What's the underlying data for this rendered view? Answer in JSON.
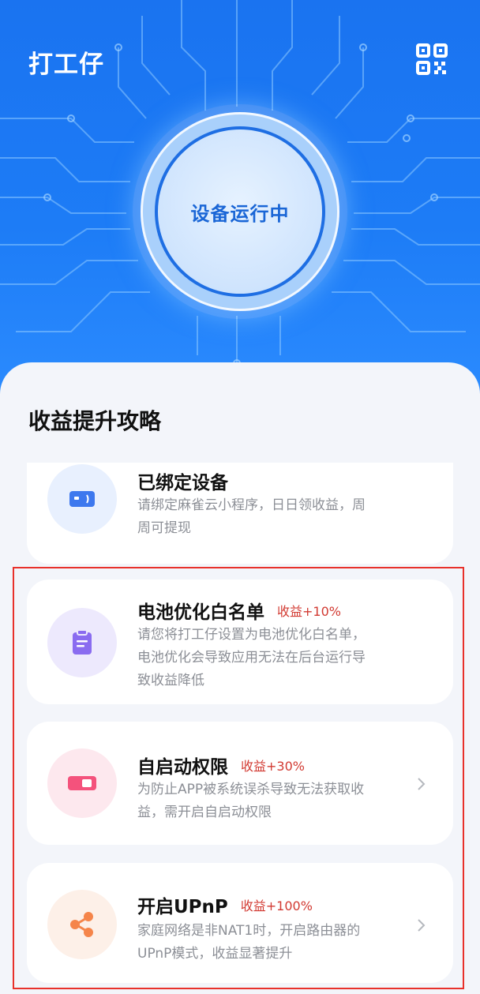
{
  "header": {
    "app_title": "打工仔",
    "qr_icon": "qr-code-icon"
  },
  "status": {
    "text": "设备运行中"
  },
  "section": {
    "title": "收益提升攻略"
  },
  "cards": [
    {
      "title": "已绑定设备",
      "badge": "",
      "desc_lines": [
        "请绑定麻雀云小程序，日日领收益，周",
        "周可提现"
      ],
      "icon": "device-card-icon",
      "icon_bg": "#e8f0fe",
      "icon_color": "#3d78ee"
    },
    {
      "title": "电池优化白名单",
      "badge": "收益+10%",
      "desc_lines": [
        "请您将打工仔设置为电池优化白名单，",
        "电池优化会导致应用无法在后台运行导",
        "致收益降低"
      ],
      "icon": "clipboard-icon",
      "icon_bg": "#ede9fd",
      "icon_color": "#8a6cf0"
    },
    {
      "title": "自启动权限",
      "badge": "收益+30%",
      "desc_lines": [
        "为防止APP被系统误杀导致无法获取收",
        "益，需开启自启动权限"
      ],
      "icon": "toggle-icon",
      "icon_bg": "#fde8ee",
      "icon_color": "#f4527c"
    },
    {
      "title": "开启UPnP",
      "badge": "收益+100%",
      "desc_lines": [
        "家庭网络是非NAT1时，开启路由器的",
        "UPnP模式，收益显著提升"
      ],
      "icon": "share-nodes-icon",
      "icon_bg": "#fdf0e8",
      "icon_color": "#f5854a"
    }
  ],
  "colors": {
    "brand": "#1a73f0",
    "badge": "#d23a32",
    "highlight": "#e8312b"
  }
}
